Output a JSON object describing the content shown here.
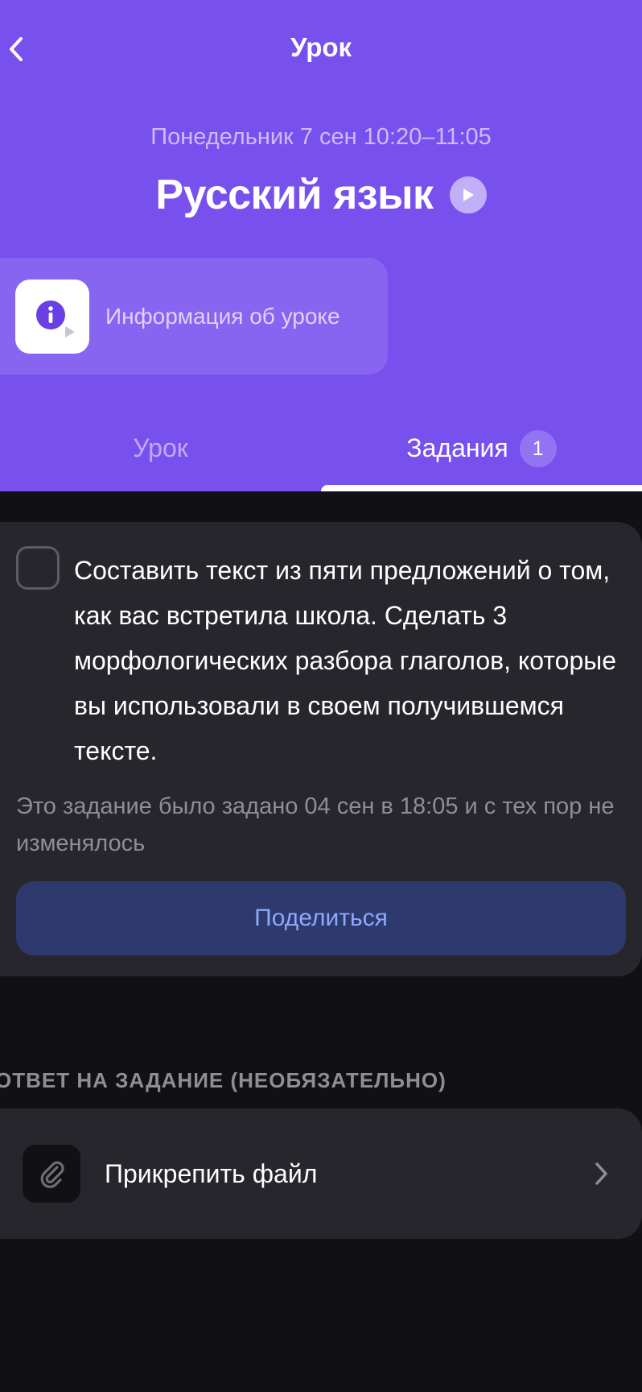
{
  "header": {
    "title": "Урок",
    "lesson_time": "Понедельник 7 сен  10:20–11:05",
    "subject": "Русский язык",
    "info_card_label": "Информация об уроке"
  },
  "tabs": [
    {
      "label": "Урок",
      "active": false
    },
    {
      "label": "Задания",
      "active": true,
      "badge": "1"
    }
  ],
  "task": {
    "text": "Составить текст из пяти предложений о том, как вас встретила школа. Сделать 3 морфологических разбора глаголов, которые вы использовали в своем получившемся тексте.",
    "meta": "Это задание было задано 04 сен в 18:05 и с тех пор не изменялось",
    "share_label": "Поделиться",
    "checked": false
  },
  "answer": {
    "heading": "ОТВЕТ НА ЗАДАНИЕ (НЕОБЯЗАТЕЛЬНО)",
    "attach_label": "Прикрепить файл"
  },
  "icons": {
    "back": "chevron-left-icon",
    "play": "play-icon",
    "info": "info-icon",
    "clip": "paperclip-icon",
    "chevron": "chevron-right-icon"
  },
  "colors": {
    "header_bg": "#7750ee",
    "page_bg": "#111015",
    "card_bg": "#27262c",
    "share_bg": "#2e3a6d",
    "share_text": "#8fa8ff",
    "info_icon": "#6a3fe3"
  }
}
